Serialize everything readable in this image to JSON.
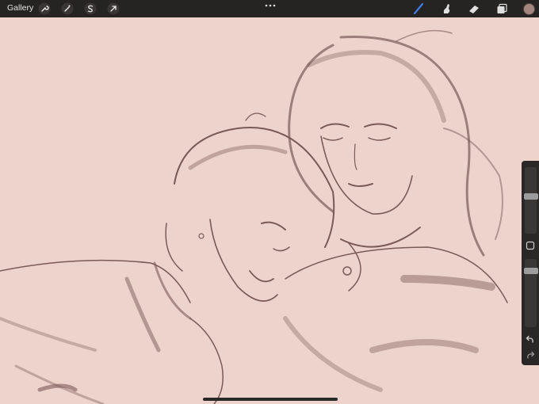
{
  "toolbar": {
    "gallery_label": "Gallery",
    "left_tools": [
      "wrench-icon",
      "magic-wand-icon",
      "selection-icon",
      "transform-icon"
    ],
    "right_tools": [
      "brush-icon",
      "smudge-icon",
      "eraser-icon",
      "layers-icon"
    ],
    "active_tool": "brush",
    "accent_color": "#3f7ee8",
    "current_color": "#a58580"
  },
  "canvas": {
    "background_color": "#eed3cc",
    "stroke_color": "#6e4d4b"
  },
  "sidebar": {
    "brush_size_level": 0.17,
    "opacity_level": 0.05
  }
}
